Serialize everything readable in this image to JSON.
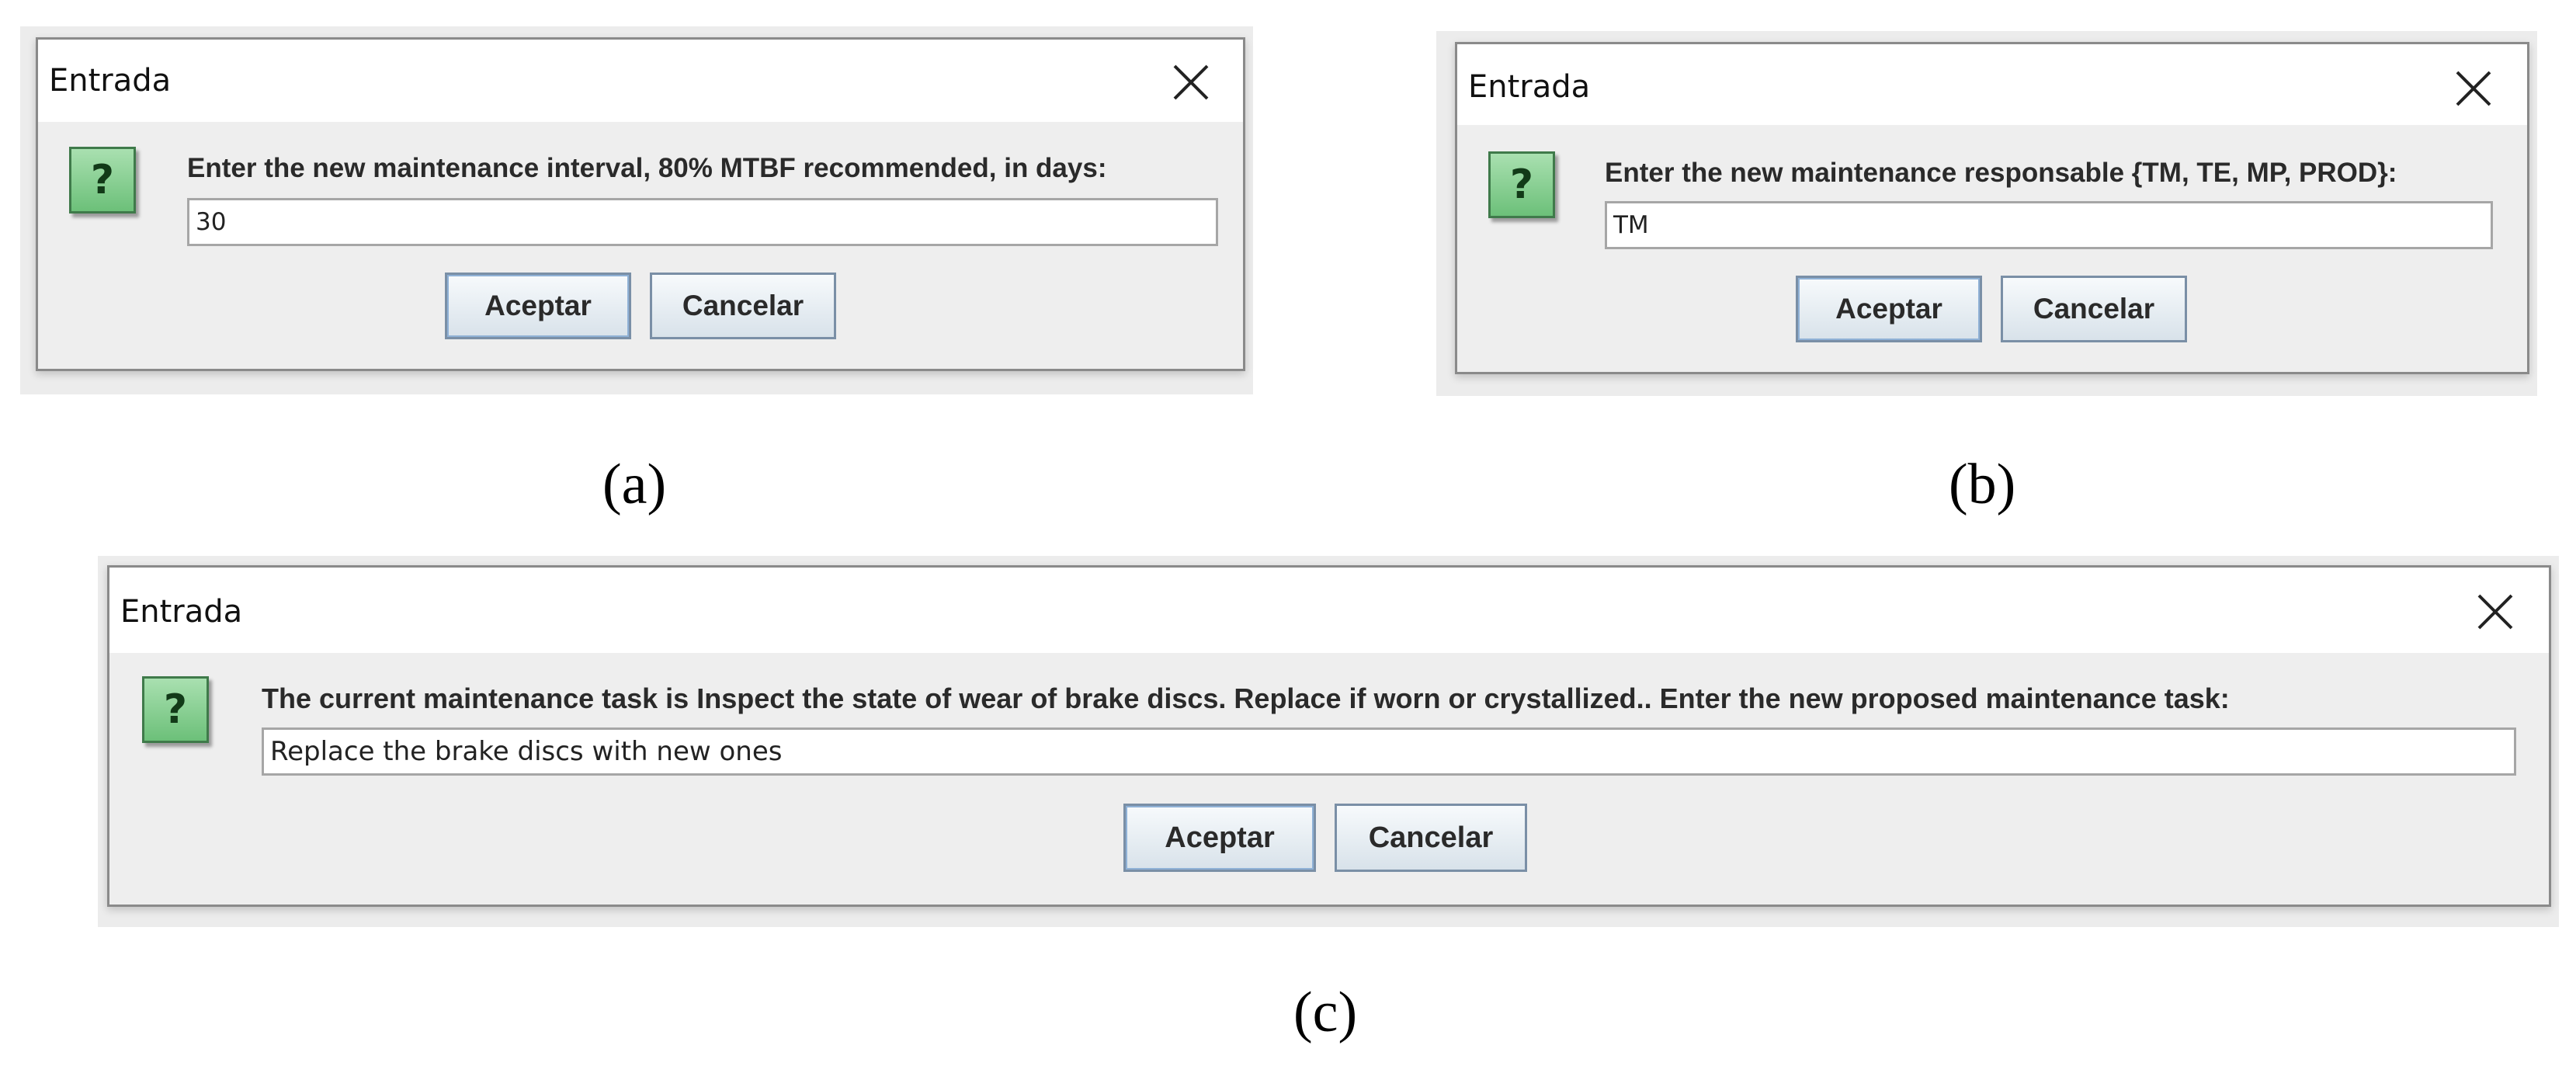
{
  "dialogs": [
    {
      "title": "Entrada",
      "prompt": "Enter the new maintenance interval, 80% MTBF recommended, in days:",
      "value": "30",
      "accept_label": "Aceptar",
      "cancel_label": "Cancelar",
      "icon": "question-icon",
      "caption": "(a)"
    },
    {
      "title": "Entrada",
      "prompt": "Enter the new maintenance responsable {TM, TE, MP, PROD}:",
      "value": "TM",
      "accept_label": "Aceptar",
      "cancel_label": "Cancelar",
      "icon": "question-icon",
      "caption": "(b)"
    },
    {
      "title": "Entrada",
      "prompt": "The current maintenance task is Inspect the state of wear of brake discs. Replace if worn or crystallized.. Enter the new proposed maintenance task:",
      "value": "Replace the brake discs with new ones",
      "accept_label": "Aceptar",
      "cancel_label": "Cancelar",
      "icon": "question-icon",
      "caption": "(c)"
    }
  ],
  "colors": {
    "dialog_bg": "#eeeeee",
    "titlebar_bg": "#ffffff",
    "icon_green": "#6cc079",
    "button_border": "#7a8fa6"
  }
}
